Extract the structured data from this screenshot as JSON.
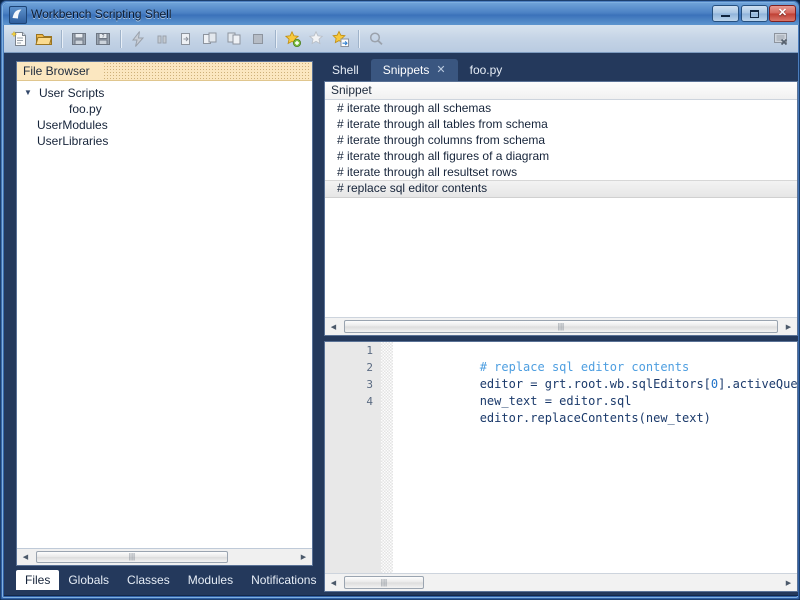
{
  "window": {
    "title": "Workbench Scripting Shell",
    "icon": "app-icon",
    "controls": {
      "minimize": "minimize",
      "maximize": "maximize",
      "close": "✕"
    }
  },
  "toolbar": {
    "items": [
      {
        "name": "new-script-icon",
        "type": "icon"
      },
      {
        "name": "open-script-icon",
        "type": "icon"
      },
      {
        "name": "separator",
        "type": "sep"
      },
      {
        "name": "save-script-icon",
        "type": "icon"
      },
      {
        "name": "save-script-as-icon",
        "type": "icon"
      },
      {
        "name": "separator",
        "type": "sep"
      },
      {
        "name": "run-script-icon",
        "type": "icon"
      },
      {
        "name": "pause-icon",
        "type": "icon"
      },
      {
        "name": "step-into-icon",
        "type": "icon"
      },
      {
        "name": "step-over-icon",
        "type": "icon"
      },
      {
        "name": "step-out-icon",
        "type": "icon"
      },
      {
        "name": "stop-icon",
        "type": "icon"
      },
      {
        "name": "separator",
        "type": "sep"
      },
      {
        "name": "add-snippet-icon",
        "type": "icon"
      },
      {
        "name": "delete-snippet-icon",
        "type": "icon"
      },
      {
        "name": "insert-snippet-icon",
        "type": "icon"
      },
      {
        "name": "separator",
        "type": "sep"
      },
      {
        "name": "search-icon",
        "type": "icon"
      }
    ],
    "right_icon": "close-panel-icon"
  },
  "file_browser": {
    "header": "File Browser",
    "tree": [
      {
        "label": "User Scripts",
        "level": 0,
        "expanded": true,
        "twisty": "▼"
      },
      {
        "label": "foo.py",
        "level": 2,
        "expanded": false,
        "twisty": ""
      },
      {
        "label": "UserModules",
        "level": 1,
        "expanded": false,
        "twisty": ""
      },
      {
        "label": "UserLibraries",
        "level": 1,
        "expanded": false,
        "twisty": ""
      }
    ]
  },
  "bottom_tabs": {
    "items": [
      {
        "label": "Files",
        "active": true
      },
      {
        "label": "Globals",
        "active": false
      },
      {
        "label": "Classes",
        "active": false
      },
      {
        "label": "Modules",
        "active": false
      },
      {
        "label": "Notifications",
        "active": false
      }
    ]
  },
  "editor_tabs": {
    "items": [
      {
        "label": "Shell",
        "active": false,
        "closable": false
      },
      {
        "label": "Snippets",
        "active": true,
        "closable": true,
        "close_glyph": "✕"
      },
      {
        "label": "foo.py",
        "active": false,
        "closable": false
      }
    ]
  },
  "snippets": {
    "column_header": "Snippet",
    "rows": [
      {
        "text": "# iterate through all schemas",
        "selected": false
      },
      {
        "text": "# iterate through all tables from schema",
        "selected": false
      },
      {
        "text": "# iterate through columns from schema",
        "selected": false
      },
      {
        "text": "# iterate through all figures of a diagram",
        "selected": false
      },
      {
        "text": "# iterate through all resultset rows",
        "selected": false
      },
      {
        "text": "# replace sql editor contents",
        "selected": true
      }
    ]
  },
  "code_editor": {
    "line_numbers": [
      "1",
      "2",
      "3",
      "4"
    ],
    "lines": [
      {
        "segments": [
          {
            "text": "# replace sql editor contents",
            "style": "comment"
          }
        ]
      },
      {
        "segments": [
          {
            "text": "editor = grt.root.wb.sqlEditors[",
            "style": "plain"
          },
          {
            "text": "0",
            "style": "number"
          },
          {
            "text": "].activeQueryBuffer",
            "style": "plain"
          }
        ]
      },
      {
        "segments": [
          {
            "text": "new_text = editor.sql",
            "style": "plain"
          }
        ]
      },
      {
        "segments": [
          {
            "text": "editor.replaceContents(new_text)",
            "style": "plain"
          }
        ]
      }
    ]
  },
  "scrollbars": {
    "left_arrow": "◀",
    "right_arrow": "▶",
    "grip": "|||"
  },
  "colors": {
    "titlebar_accent": "#4b81c4",
    "close_button": "#bf4034",
    "panel_navy": "#24395c",
    "tab_active": "#3a5680",
    "file_browser_header": "#fbe7c0",
    "code_comment": "#4d9ee0",
    "code_text": "#1b3a6b",
    "code_number": "#1f72c8"
  }
}
